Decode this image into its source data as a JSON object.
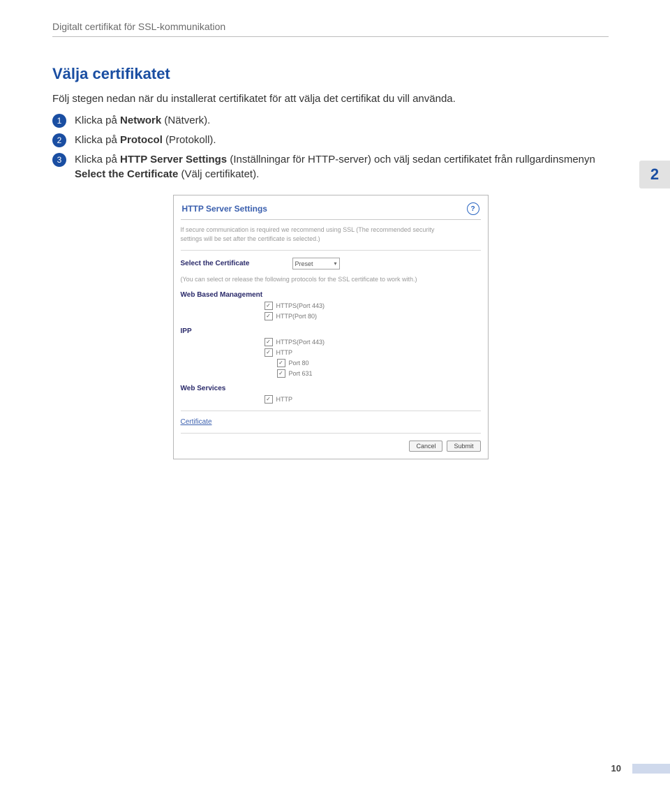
{
  "doc_header": "Digitalt certifikat för SSL-kommunikation",
  "title": "Välja certifikatet",
  "intro": "Följ stegen nedan när du installerat certifikatet för att välja det certifikat du vill använda.",
  "side_tab": "2",
  "steps": {
    "s1": {
      "num": "1",
      "pre": "Klicka på ",
      "bold": "Network",
      "post": " (Nätverk)."
    },
    "s2": {
      "num": "2",
      "pre": "Klicka på ",
      "bold": "Protocol",
      "post": " (Protokoll)."
    },
    "s3": {
      "num": "3",
      "pre": "Klicka på ",
      "bold": "HTTP Server Settings",
      "mid": " (Inställningar för HTTP-server) och välj sedan certifikatet från rullgardinsmenyn ",
      "bold2": "Select the Certificate",
      "post": " (Välj certifikatet)."
    }
  },
  "panel": {
    "title": "HTTP Server Settings",
    "help": "?",
    "note1a": "If secure communication is required we recommend using SSL (The recommended security",
    "note1b": "settings will be set after the certificate is selected.)",
    "select_label": "Select the Certificate",
    "select_value": "Preset",
    "note2": "(You can select or release the following protocols for the SSL certificate to work with.)",
    "wbm_label": "Web Based Management",
    "ipp_label": "IPP",
    "ws_label": "Web Services",
    "opts": {
      "wbm1": "HTTPS(Port 443)",
      "wbm2": "HTTP(Port 80)",
      "ipp1": "HTTPS(Port 443)",
      "ipp2": "HTTP",
      "ipp3": "Port 80",
      "ipp4": "Port 631",
      "ws1": "HTTP"
    },
    "cert_link": "Certificate",
    "cancel": "Cancel",
    "submit": "Submit",
    "check": "✓"
  },
  "page_num": "10"
}
